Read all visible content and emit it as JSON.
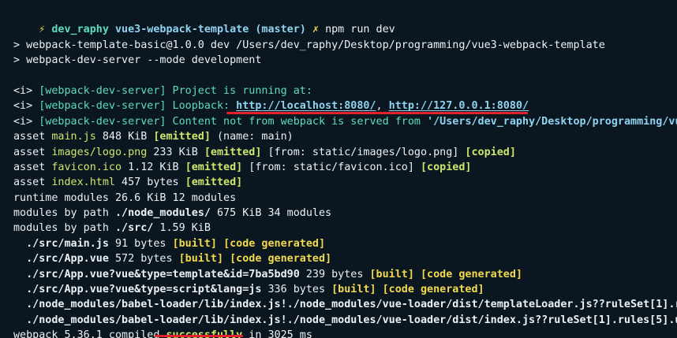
{
  "terminal": {
    "prompt": {
      "symbol": "⚡",
      "user": "dev_raphy",
      "project": "vue3-webpack-template",
      "branch": "(master)",
      "status": "✗",
      "command": "npm run dev"
    },
    "lines": [
      [
        {
          "t": "",
          "c": "w"
        }
      ],
      [
        {
          "t": "> webpack-template-basic@1.0.0 dev /Users/dev_raphy/Desktop/programming/vue3-webpack-template",
          "c": "w"
        }
      ],
      [
        {
          "t": "> webpack-dev-server --mode development",
          "c": "w"
        }
      ],
      [
        {
          "t": "",
          "c": "w"
        }
      ],
      [
        {
          "t": "<i> ",
          "c": "w"
        },
        {
          "t": "[webpack-dev-server] Project is running at:",
          "c": "c"
        }
      ],
      [
        {
          "t": "<i> ",
          "c": "w"
        },
        {
          "t": "[webpack-dev-server] Loopback: ",
          "c": "c"
        },
        {
          "t": "http://localhost:8080/",
          "c": "b",
          "u": true,
          "b": true
        },
        {
          "t": ", ",
          "c": "w"
        },
        {
          "t": "http://127.0.0.1:8080/",
          "c": "b",
          "u": true,
          "b": true
        }
      ],
      [
        {
          "t": "<i> ",
          "c": "w"
        },
        {
          "t": "[webpack-dev-server] Content not from webpack is served from ",
          "c": "c"
        },
        {
          "t": "'/Users/dev_raphy/Desktop/programming/vue3-webpack-template/public'",
          "c": "b",
          "b": true
        }
      ],
      [
        {
          "t": "asset ",
          "c": "w"
        },
        {
          "t": "main.js",
          "c": "gy"
        },
        {
          "t": " 848 KiB ",
          "c": "w"
        },
        {
          "t": "[emitted]",
          "c": "gy",
          "b": true
        },
        {
          "t": " (name: main)",
          "c": "w"
        }
      ],
      [
        {
          "t": "asset ",
          "c": "w"
        },
        {
          "t": "images/logo.png",
          "c": "gy"
        },
        {
          "t": " 233 KiB ",
          "c": "w"
        },
        {
          "t": "[emitted]",
          "c": "gy",
          "b": true
        },
        {
          "t": " [from: static/images/logo.png] ",
          "c": "w"
        },
        {
          "t": "[copied]",
          "c": "gy",
          "b": true
        }
      ],
      [
        {
          "t": "asset ",
          "c": "w"
        },
        {
          "t": "favicon.ico",
          "c": "gy"
        },
        {
          "t": " 1.12 KiB ",
          "c": "w"
        },
        {
          "t": "[emitted]",
          "c": "gy",
          "b": true
        },
        {
          "t": " [from: static/favicon.ico] ",
          "c": "w"
        },
        {
          "t": "[copied]",
          "c": "gy",
          "b": true
        }
      ],
      [
        {
          "t": "asset ",
          "c": "w"
        },
        {
          "t": "index.html",
          "c": "gy"
        },
        {
          "t": " 457 bytes ",
          "c": "w"
        },
        {
          "t": "[emitted]",
          "c": "gy",
          "b": true
        }
      ],
      [
        {
          "t": "runtime modules 26.6 KiB 12 modules",
          "c": "w"
        }
      ],
      [
        {
          "t": "modules by path ",
          "c": "w"
        },
        {
          "t": "./node_modules/",
          "c": "w",
          "b": true
        },
        {
          "t": " 675 KiB 34 modules",
          "c": "w"
        }
      ],
      [
        {
          "t": "modules by path ",
          "c": "w"
        },
        {
          "t": "./src/",
          "c": "w",
          "b": true
        },
        {
          "t": " 1.59 KiB",
          "c": "w"
        }
      ],
      [
        {
          "t": "  ./src/main.js",
          "c": "w",
          "b": true
        },
        {
          "t": " 91 bytes ",
          "c": "w"
        },
        {
          "t": "[built]",
          "c": "y",
          "b": true
        },
        {
          "t": " ",
          "c": "w"
        },
        {
          "t": "[code generated]",
          "c": "y",
          "b": true
        }
      ],
      [
        {
          "t": "  ./src/App.vue",
          "c": "w",
          "b": true
        },
        {
          "t": " 572 bytes ",
          "c": "w"
        },
        {
          "t": "[built]",
          "c": "y",
          "b": true
        },
        {
          "t": " ",
          "c": "w"
        },
        {
          "t": "[code generated]",
          "c": "y",
          "b": true
        }
      ],
      [
        {
          "t": "  ./src/App.vue?vue&type=template&id=7ba5bd90",
          "c": "w",
          "b": true
        },
        {
          "t": " 239 bytes ",
          "c": "w"
        },
        {
          "t": "[built]",
          "c": "y",
          "b": true
        },
        {
          "t": " ",
          "c": "w"
        },
        {
          "t": "[code generated]",
          "c": "y",
          "b": true
        }
      ],
      [
        {
          "t": "  ./src/App.vue?vue&type=script&lang=js",
          "c": "w",
          "b": true
        },
        {
          "t": " 336 bytes ",
          "c": "w"
        },
        {
          "t": "[built]",
          "c": "y",
          "b": true
        },
        {
          "t": " ",
          "c": "w"
        },
        {
          "t": "[code generated]",
          "c": "y",
          "b": true
        }
      ],
      [
        {
          "t": "  ./node_modules/babel-loader/lib/index.js!./node_modules/vue-loader/dist/templateLoader.js??ruleSet[1].r",
          "c": "w",
          "b": true
        }
      ],
      [
        {
          "t": "  ./node_modules/babel-loader/lib/index.js!./node_modules/vue-loader/dist/index.js??ruleSet[1].rules[5].u",
          "c": "w",
          "b": true
        }
      ],
      [
        {
          "t": "webpack 5.36.1 compiled ",
          "c": "w"
        },
        {
          "t": "successfully",
          "c": "gy",
          "b": true
        },
        {
          "t": " in 3025 ms",
          "c": "w"
        }
      ]
    ]
  },
  "colors": {
    "background": "#0a1620",
    "highlight_mark": "#e0232c"
  }
}
